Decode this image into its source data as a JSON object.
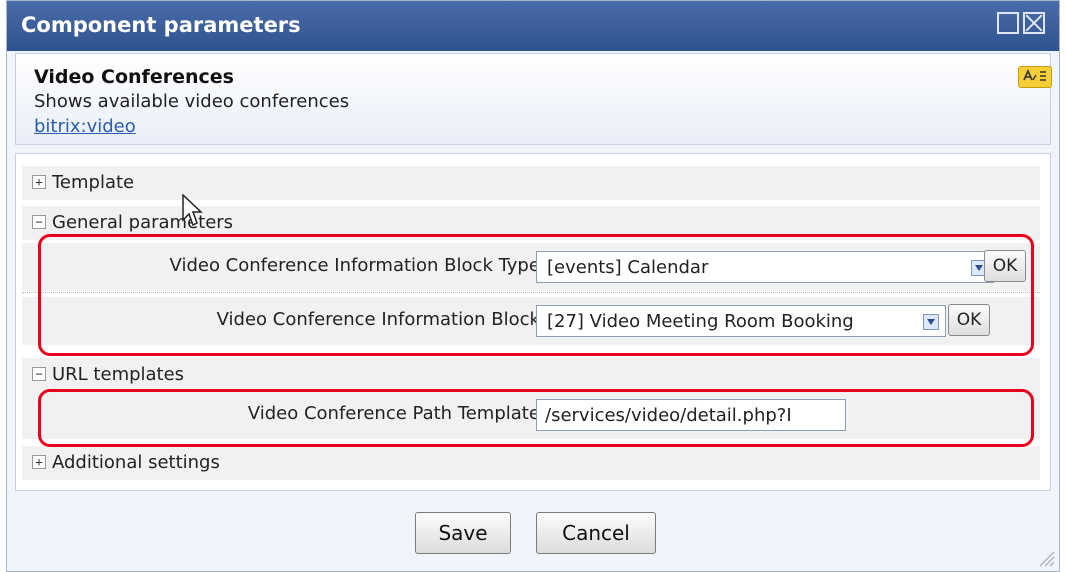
{
  "window": {
    "title": "Component parameters"
  },
  "component": {
    "name": "Video Conferences",
    "description": "Shows available video conferences",
    "link": "bitrix:video"
  },
  "sections": {
    "template": {
      "label": "Template",
      "toggle": "+"
    },
    "general": {
      "label": "General parameters",
      "toggle": "−"
    },
    "url": {
      "label": "URL templates",
      "toggle": "−"
    },
    "additional": {
      "label": "Additional settings",
      "toggle": "+"
    }
  },
  "params": {
    "block_type": {
      "label": "Video Conference Information Block Type:",
      "value": "[events] Calendar",
      "ok": "OK"
    },
    "block": {
      "label": "Video Conference Information Block:",
      "value": "[27] Video Meeting Room Booking",
      "ok": "OK"
    },
    "path_template": {
      "label": "Video Conference Path Template:",
      "value": "/services/video/detail.php?I"
    }
  },
  "buttons": {
    "save": "Save",
    "cancel": "Cancel"
  },
  "colors": {
    "titlebar": "#2f5290",
    "highlight": "#e8001c",
    "link": "#2a5dae"
  }
}
